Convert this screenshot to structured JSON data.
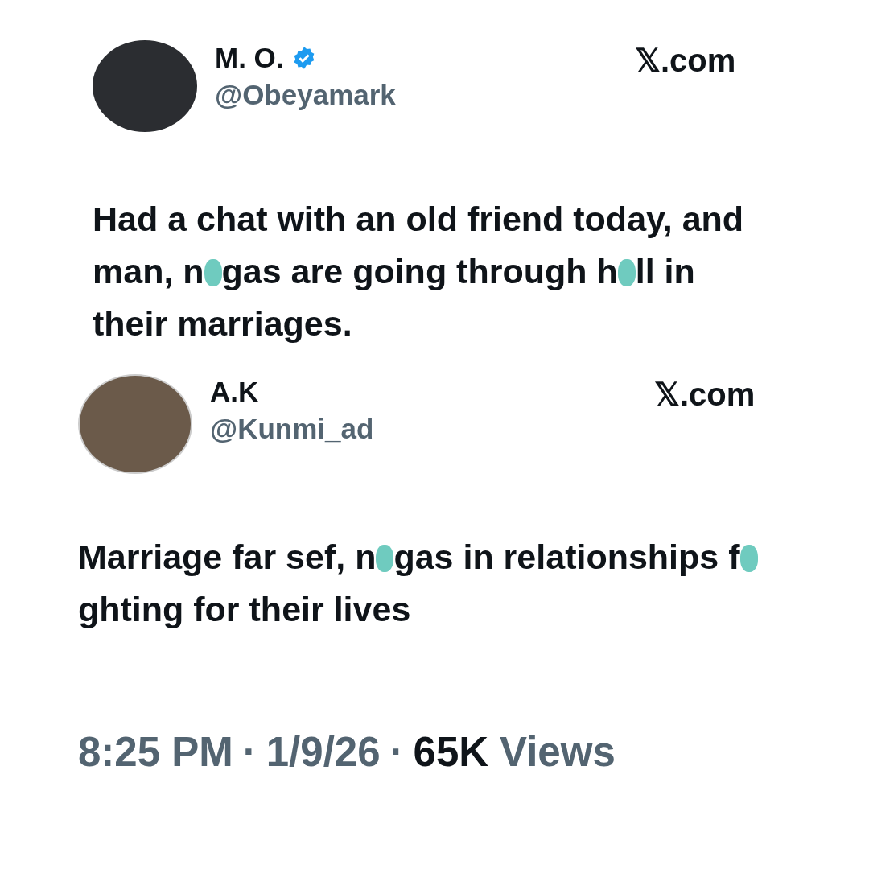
{
  "tweets": [
    {
      "name": "M. O.",
      "verified": true,
      "handle": "@Obeyamark",
      "site": "𝕏.com",
      "kind": "plain",
      "text": [
        {
          "kind": "text",
          "text": "Had a chat with an old friend today, and man, n"
        },
        {
          "kind": "blot"
        },
        {
          "kind": "text",
          "text": "gas are going through h"
        },
        {
          "kind": "blot"
        },
        {
          "kind": "text",
          "text": "ll in their marriages."
        }
      ]
    },
    {
      "name": "A.K",
      "verified": false,
      "handle": "@Kunmi_ad",
      "site": "𝕏.com",
      "kind": "photo",
      "text": [
        {
          "kind": "text",
          "text": "Marriage far sef, n"
        },
        {
          "kind": "blot"
        },
        {
          "kind": "text",
          "text": "gas in relationships f"
        },
        {
          "kind": "blot"
        },
        {
          "kind": "text",
          "text": "ghting for their lives"
        }
      ]
    }
  ],
  "footer": {
    "time": "8:25 PM",
    "date": "1/9/26",
    "views_count": "65K",
    "views_label": "Views",
    "separator": "·"
  }
}
